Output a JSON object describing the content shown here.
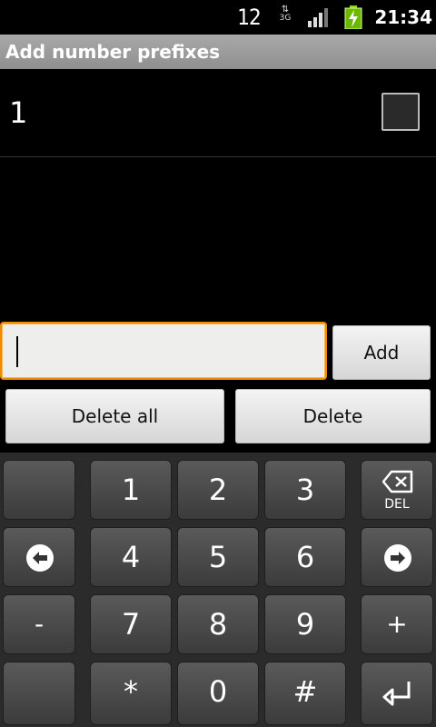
{
  "statusbar": {
    "badge": "12",
    "network": "3G",
    "time": "21:34",
    "icons": [
      "data-activity-icon",
      "signal-icon",
      "battery-charging-icon"
    ]
  },
  "titlebar": {
    "title": "Add number prefixes"
  },
  "list": {
    "items": [
      {
        "label": "1",
        "checked": false
      }
    ]
  },
  "input": {
    "value": "",
    "placeholder": ""
  },
  "buttons": {
    "add": "Add",
    "delete_all": "Delete all",
    "delete": "Delete"
  },
  "keyboard": {
    "rows": [
      [
        "",
        "1",
        "2",
        "3",
        "DEL"
      ],
      [
        "left-arrow",
        "4",
        "5",
        "6",
        "right-arrow"
      ],
      [
        "-",
        "7",
        "8",
        "9",
        "+"
      ],
      [
        "",
        "*",
        "0",
        "#",
        "enter"
      ]
    ],
    "keys": {
      "k1": "1",
      "k2": "2",
      "k3": "3",
      "k4": "4",
      "k5": "5",
      "k6": "6",
      "k7": "7",
      "k8": "8",
      "k9": "9",
      "kstar": "*",
      "k0": "0",
      "khash": "#",
      "kminus": "-",
      "kplus": "+",
      "kdel": "DEL"
    }
  },
  "colors": {
    "focus": "#f08a00",
    "titlebar": "#9c9c9c",
    "keyboard_bg": "#2b2b2b"
  }
}
